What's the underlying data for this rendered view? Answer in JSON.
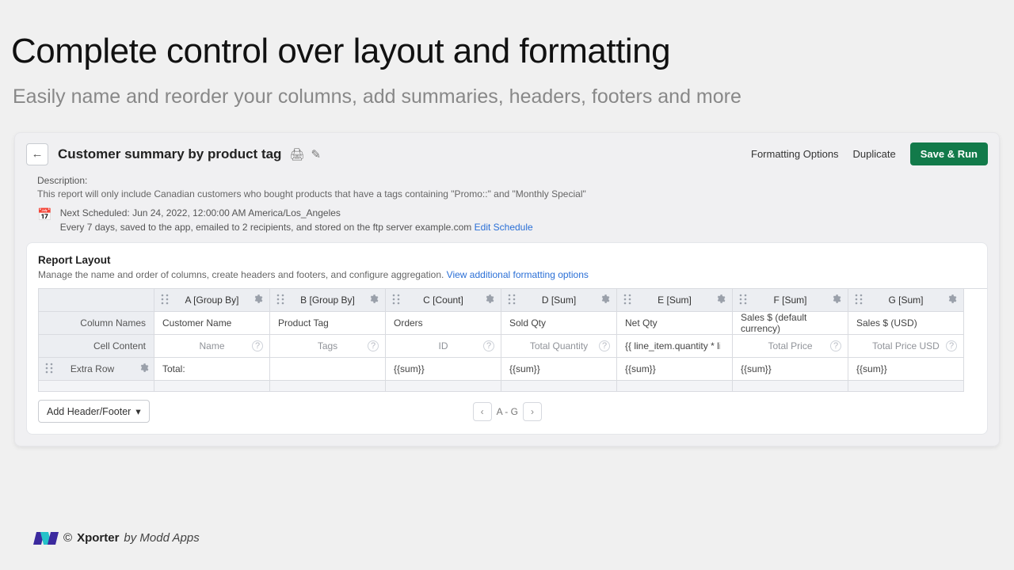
{
  "slide": {
    "title": "Complete control over layout and formatting",
    "subtitle": "Easily name and reorder your columns, add summaries, headers, footers and more"
  },
  "header": {
    "report_title": "Customer summary by product tag",
    "formatting_options": "Formatting Options",
    "duplicate": "Duplicate",
    "save_run": "Save & Run"
  },
  "description": {
    "label": "Description:",
    "text": "This report will only include Canadian customers who bought products that have a tags containing \"Promo::\" and \"Monthly Special\"",
    "next_scheduled": "Next Scheduled: Jun 24, 2022, 12:00:00 AM America/Los_Angeles",
    "frequency_prefix": "Every 7 days, saved to the app, emailed to 2 recipients, and stored on the ftp server example.com ",
    "edit_link": "Edit Schedule"
  },
  "layout": {
    "title": "Report Layout",
    "sub_prefix": "Manage the name and order of columns, create headers and footers, and configure aggregation. ",
    "sub_link": "View additional formatting options",
    "row_labels": {
      "column_names": "Column Names",
      "cell_content": "Cell Content",
      "extra_row": "Extra Row"
    },
    "columns": [
      {
        "code": "A [Group By]",
        "name": "Customer Name",
        "content": "Name",
        "content_align": "center",
        "has_q": true,
        "extra": "Total:"
      },
      {
        "code": "B [Group By]",
        "name": "Product Tag",
        "content": "Tags",
        "content_align": "center",
        "has_q": true,
        "extra": ""
      },
      {
        "code": "C [Count]",
        "name": "Orders",
        "content": "ID",
        "content_align": "center",
        "has_q": true,
        "extra": "{{sum}}"
      },
      {
        "code": "D [Sum]",
        "name": "Sold Qty",
        "content": "Total Quantity",
        "content_align": "center",
        "has_q": true,
        "extra": "{{sum}}"
      },
      {
        "code": "E [Sum]",
        "name": "Net Qty",
        "content": "{{ line_item.quantity * line_it",
        "content_align": "left",
        "has_q": false,
        "extra": "{{sum}}"
      },
      {
        "code": "F [Sum]",
        "name": "Sales $ (default currency)",
        "content": "Total Price",
        "content_align": "center",
        "has_q": true,
        "extra": "{{sum}}"
      },
      {
        "code": "G [Sum]",
        "name": "Sales $ (USD)",
        "content": "Total Price USD",
        "content_align": "center",
        "has_q": true,
        "extra": "{{sum}}"
      }
    ],
    "add_hf": "Add Header/Footer",
    "pager": "A - G"
  },
  "footer": {
    "copyright": "© ",
    "product": "Xporter",
    "by": " by Modd Apps"
  }
}
